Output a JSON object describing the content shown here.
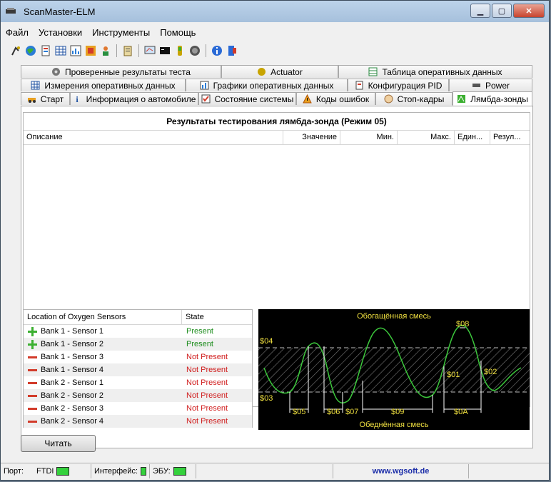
{
  "window": {
    "title": "ScanMaster-ELM",
    "minimize": "▁",
    "maximize": "▢",
    "close": "✕"
  },
  "menu": [
    "Файл",
    "Установки",
    "Инструменты",
    "Помощь"
  ],
  "tabs": {
    "row1": [
      "Проверенные результаты теста",
      "Actuator",
      "Таблица оперативных данных"
    ],
    "row2": [
      "Измерения оперативных данных",
      "Графики оперативных данных",
      "Конфигурация PID",
      "Power"
    ],
    "row3": [
      "Старт",
      "Информация о автомобиле",
      "Состояние системы",
      "Коды ошибок",
      "Стоп-кадры",
      "Лямбда-зонды"
    ]
  },
  "results": {
    "title": "Результаты тестирования лямбда-зонда (Режим 05)",
    "columns": [
      "Описание",
      "Значение",
      "Мин.",
      "Макс.",
      "Един...",
      "Резул..."
    ]
  },
  "sensors": {
    "columns": [
      "Location of Oxygen Sensors",
      "State"
    ],
    "rows": [
      {
        "location": "Bank 1 - Sensor 1",
        "state": "Present"
      },
      {
        "location": "Bank 1 - Sensor 2",
        "state": "Present"
      },
      {
        "location": "Bank 1 - Sensor 3",
        "state": "Not Present"
      },
      {
        "location": "Bank 1 - Sensor 4",
        "state": "Not Present"
      },
      {
        "location": "Bank 2 - Sensor 1",
        "state": "Not Present"
      },
      {
        "location": "Bank 2 - Sensor 2",
        "state": "Not Present"
      },
      {
        "location": "Bank 2 - Sensor 3",
        "state": "Not Present"
      },
      {
        "location": "Bank 2 - Sensor 4",
        "state": "Not Present"
      }
    ],
    "present_color": "#1c8c1c",
    "absent_color": "#d01c1c"
  },
  "diagram": {
    "top_label": "Обогащённая смесь",
    "bottom_label": "Обеднённая смесь",
    "labels": {
      "l04": "$04",
      "l03": "$03",
      "l08": "$08",
      "l01": "$01",
      "l02": "$02",
      "l05": "$05",
      "l06": "$06",
      "l07": "$07",
      "l09": "$09",
      "l0a": "$0A"
    },
    "label_color": "#f0e040",
    "wave_color": "#3cc83c"
  },
  "read_button": "Читать",
  "status": {
    "port_label": "Порт:",
    "port_value": "FTDI",
    "interface_label": "Интерфейс:",
    "ecu_label": "ЭБУ:",
    "link": "www.wgsoft.de"
  }
}
